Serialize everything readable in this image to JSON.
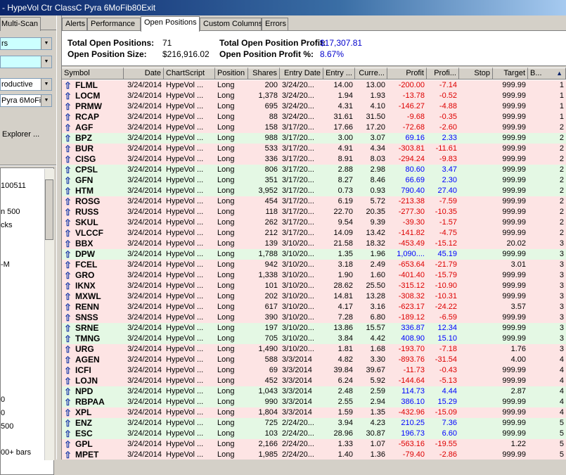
{
  "window": {
    "title": "- HypeVol Ctr ClassC Pyra 6MoFib80Exit"
  },
  "left_panel": {
    "tab_label": "Multi-Scan",
    "combo1": "rs",
    "combo2": "",
    "combo3": "roductive",
    "combo4": "Pyra 6MoFib",
    "explorer_label": "Explorer ...",
    "list_items": [
      "100511",
      "n 500",
      "cks",
      "-M",
      "0",
      "0",
      "500",
      "00+ bars"
    ]
  },
  "tabs": [
    "Alerts",
    "Performance",
    "Open Positions",
    "Custom Columns",
    "Errors"
  ],
  "summary": {
    "total_positions_label": "Total Open Positions:",
    "total_positions_value": "71",
    "position_size_label": "Open Position Size:",
    "position_size_value": "$216,916.02",
    "profit_label": "Total Open Position Profit:",
    "profit_value": "$17,307.81",
    "profit_pct_label": "Open Position Profit %:",
    "profit_pct_value": "8.67%"
  },
  "table": {
    "columns": [
      "Symbol",
      "Date",
      "ChartScript",
      "Position",
      "Shares",
      "Entry Date",
      "Entry ...",
      "Curre...",
      "Profit",
      "Profi...",
      "Stop",
      "Target",
      "B..."
    ],
    "sort_indicator": "▲",
    "rows": [
      {
        "symbol": "FLML",
        "date": "3/24/2014",
        "script": "HypeVol ...",
        "position": "Long",
        "shares": "200",
        "entry_date": "3/24/20...",
        "entry": "14.00",
        "current": "13.00",
        "profit": "-200.00",
        "profit_pct": "-7.14",
        "stop": "",
        "target": "999.99",
        "b": "1",
        "color": "red"
      },
      {
        "symbol": "LOCM",
        "date": "3/24/2014",
        "script": "HypeVol ...",
        "position": "Long",
        "shares": "1,378",
        "entry_date": "3/24/20...",
        "entry": "1.94",
        "current": "1.93",
        "profit": "-13.78",
        "profit_pct": "-0.52",
        "stop": "",
        "target": "999.99",
        "b": "1",
        "color": "red"
      },
      {
        "symbol": "PRMW",
        "date": "3/24/2014",
        "script": "HypeVol ...",
        "position": "Long",
        "shares": "695",
        "entry_date": "3/24/20...",
        "entry": "4.31",
        "current": "4.10",
        "profit": "-146.27",
        "profit_pct": "-4.88",
        "stop": "",
        "target": "999.99",
        "b": "1",
        "color": "red"
      },
      {
        "symbol": "RCAP",
        "date": "3/24/2014",
        "script": "HypeVol ...",
        "position": "Long",
        "shares": "88",
        "entry_date": "3/24/20...",
        "entry": "31.61",
        "current": "31.50",
        "profit": "-9.68",
        "profit_pct": "-0.35",
        "stop": "",
        "target": "999.99",
        "b": "1",
        "color": "red"
      },
      {
        "symbol": "AGF",
        "date": "3/24/2014",
        "script": "HypeVol ...",
        "position": "Long",
        "shares": "158",
        "entry_date": "3/17/20...",
        "entry": "17.66",
        "current": "17.20",
        "profit": "-72.68",
        "profit_pct": "-2.60",
        "stop": "",
        "target": "999.99",
        "b": "2",
        "color": "red"
      },
      {
        "symbol": "BPZ",
        "date": "3/24/2014",
        "script": "HypeVol ...",
        "position": "Long",
        "shares": "988",
        "entry_date": "3/17/20...",
        "entry": "3.00",
        "current": "3.07",
        "profit": "69.16",
        "profit_pct": "2.33",
        "stop": "",
        "target": "999.99",
        "b": "2",
        "color": "green"
      },
      {
        "symbol": "BUR",
        "date": "3/24/2014",
        "script": "HypeVol ...",
        "position": "Long",
        "shares": "533",
        "entry_date": "3/17/20...",
        "entry": "4.91",
        "current": "4.34",
        "profit": "-303.81",
        "profit_pct": "-11.61",
        "stop": "",
        "target": "999.99",
        "b": "2",
        "color": "red"
      },
      {
        "symbol": "CISG",
        "date": "3/24/2014",
        "script": "HypeVol ...",
        "position": "Long",
        "shares": "336",
        "entry_date": "3/17/20...",
        "entry": "8.91",
        "current": "8.03",
        "profit": "-294.24",
        "profit_pct": "-9.83",
        "stop": "",
        "target": "999.99",
        "b": "2",
        "color": "red"
      },
      {
        "symbol": "CPSL",
        "date": "3/24/2014",
        "script": "HypeVol ...",
        "position": "Long",
        "shares": "806",
        "entry_date": "3/17/20...",
        "entry": "2.88",
        "current": "2.98",
        "profit": "80.60",
        "profit_pct": "3.47",
        "stop": "",
        "target": "999.99",
        "b": "2",
        "color": "green"
      },
      {
        "symbol": "GFN",
        "date": "3/24/2014",
        "script": "HypeVol ...",
        "position": "Long",
        "shares": "351",
        "entry_date": "3/17/20...",
        "entry": "8.27",
        "current": "8.46",
        "profit": "66.69",
        "profit_pct": "2.30",
        "stop": "",
        "target": "999.99",
        "b": "2",
        "color": "green"
      },
      {
        "symbol": "HTM",
        "date": "3/24/2014",
        "script": "HypeVol ...",
        "position": "Long",
        "shares": "3,952",
        "entry_date": "3/17/20...",
        "entry": "0.73",
        "current": "0.93",
        "profit": "790.40",
        "profit_pct": "27.40",
        "stop": "",
        "target": "999.99",
        "b": "2",
        "color": "green"
      },
      {
        "symbol": "ROSG",
        "date": "3/24/2014",
        "script": "HypeVol ...",
        "position": "Long",
        "shares": "454",
        "entry_date": "3/17/20...",
        "entry": "6.19",
        "current": "5.72",
        "profit": "-213.38",
        "profit_pct": "-7.59",
        "stop": "",
        "target": "999.99",
        "b": "2",
        "color": "red"
      },
      {
        "symbol": "RUSS",
        "date": "3/24/2014",
        "script": "HypeVol ...",
        "position": "Long",
        "shares": "118",
        "entry_date": "3/17/20...",
        "entry": "22.70",
        "current": "20.35",
        "profit": "-277.30",
        "profit_pct": "-10.35",
        "stop": "",
        "target": "999.99",
        "b": "2",
        "color": "red"
      },
      {
        "symbol": "SKUL",
        "date": "3/24/2014",
        "script": "HypeVol ...",
        "position": "Long",
        "shares": "262",
        "entry_date": "3/17/20...",
        "entry": "9.54",
        "current": "9.39",
        "profit": "-39.30",
        "profit_pct": "-1.57",
        "stop": "",
        "target": "999.99",
        "b": "2",
        "color": "red"
      },
      {
        "symbol": "VLCCF",
        "date": "3/24/2014",
        "script": "HypeVol ...",
        "position": "Long",
        "shares": "212",
        "entry_date": "3/17/20...",
        "entry": "14.09",
        "current": "13.42",
        "profit": "-141.82",
        "profit_pct": "-4.75",
        "stop": "",
        "target": "999.99",
        "b": "2",
        "color": "red"
      },
      {
        "symbol": "BBX",
        "date": "3/24/2014",
        "script": "HypeVol ...",
        "position": "Long",
        "shares": "139",
        "entry_date": "3/10/20...",
        "entry": "21.58",
        "current": "18.32",
        "profit": "-453.49",
        "profit_pct": "-15.12",
        "stop": "",
        "target": "20.02",
        "b": "3",
        "color": "red"
      },
      {
        "symbol": "DPW",
        "date": "3/24/2014",
        "script": "HypeVol ...",
        "position": "Long",
        "shares": "1,788",
        "entry_date": "3/10/20...",
        "entry": "1.35",
        "current": "1.96",
        "profit": "1,090....",
        "profit_pct": "45.19",
        "stop": "",
        "target": "999.99",
        "b": "3",
        "color": "green"
      },
      {
        "symbol": "FCEL",
        "date": "3/24/2014",
        "script": "HypeVol ...",
        "position": "Long",
        "shares": "942",
        "entry_date": "3/10/20...",
        "entry": "3.18",
        "current": "2.49",
        "profit": "-653.64",
        "profit_pct": "-21.79",
        "stop": "",
        "target": "3.01",
        "b": "3",
        "color": "red"
      },
      {
        "symbol": "GRO",
        "date": "3/24/2014",
        "script": "HypeVol ...",
        "position": "Long",
        "shares": "1,338",
        "entry_date": "3/10/20...",
        "entry": "1.90",
        "current": "1.60",
        "profit": "-401.40",
        "profit_pct": "-15.79",
        "stop": "",
        "target": "999.99",
        "b": "3",
        "color": "red"
      },
      {
        "symbol": "IKNX",
        "date": "3/24/2014",
        "script": "HypeVol ...",
        "position": "Long",
        "shares": "101",
        "entry_date": "3/10/20...",
        "entry": "28.62",
        "current": "25.50",
        "profit": "-315.12",
        "profit_pct": "-10.90",
        "stop": "",
        "target": "999.99",
        "b": "3",
        "color": "red"
      },
      {
        "symbol": "MXWL",
        "date": "3/24/2014",
        "script": "HypeVol ...",
        "position": "Long",
        "shares": "202",
        "entry_date": "3/10/20...",
        "entry": "14.81",
        "current": "13.28",
        "profit": "-308.32",
        "profit_pct": "-10.31",
        "stop": "",
        "target": "999.99",
        "b": "3",
        "color": "red"
      },
      {
        "symbol": "RENN",
        "date": "3/24/2014",
        "script": "HypeVol ...",
        "position": "Long",
        "shares": "617",
        "entry_date": "3/10/20...",
        "entry": "4.17",
        "current": "3.16",
        "profit": "-623.17",
        "profit_pct": "-24.22",
        "stop": "",
        "target": "3.57",
        "b": "3",
        "color": "red"
      },
      {
        "symbol": "SNSS",
        "date": "3/24/2014",
        "script": "HypeVol ...",
        "position": "Long",
        "shares": "390",
        "entry_date": "3/10/20...",
        "entry": "7.28",
        "current": "6.80",
        "profit": "-189.12",
        "profit_pct": "-6.59",
        "stop": "",
        "target": "999.99",
        "b": "3",
        "color": "red"
      },
      {
        "symbol": "SRNE",
        "date": "3/24/2014",
        "script": "HypeVol ...",
        "position": "Long",
        "shares": "197",
        "entry_date": "3/10/20...",
        "entry": "13.86",
        "current": "15.57",
        "profit": "336.87",
        "profit_pct": "12.34",
        "stop": "",
        "target": "999.99",
        "b": "3",
        "color": "green"
      },
      {
        "symbol": "TMNG",
        "date": "3/24/2014",
        "script": "HypeVol ...",
        "position": "Long",
        "shares": "705",
        "entry_date": "3/10/20...",
        "entry": "3.84",
        "current": "4.42",
        "profit": "408.90",
        "profit_pct": "15.10",
        "stop": "",
        "target": "999.99",
        "b": "3",
        "color": "green"
      },
      {
        "symbol": "URG",
        "date": "3/24/2014",
        "script": "HypeVol ...",
        "position": "Long",
        "shares": "1,490",
        "entry_date": "3/10/20...",
        "entry": "1.81",
        "current": "1.68",
        "profit": "-193.70",
        "profit_pct": "-7.18",
        "stop": "",
        "target": "1.76",
        "b": "3",
        "color": "red"
      },
      {
        "symbol": "AGEN",
        "date": "3/24/2014",
        "script": "HypeVol ...",
        "position": "Long",
        "shares": "588",
        "entry_date": "3/3/2014",
        "entry": "4.82",
        "current": "3.30",
        "profit": "-893.76",
        "profit_pct": "-31.54",
        "stop": "",
        "target": "4.00",
        "b": "4",
        "color": "red"
      },
      {
        "symbol": "ICFI",
        "date": "3/24/2014",
        "script": "HypeVol ...",
        "position": "Long",
        "shares": "69",
        "entry_date": "3/3/2014",
        "entry": "39.84",
        "current": "39.67",
        "profit": "-11.73",
        "profit_pct": "-0.43",
        "stop": "",
        "target": "999.99",
        "b": "4",
        "color": "red"
      },
      {
        "symbol": "LOJN",
        "date": "3/24/2014",
        "script": "HypeVol ...",
        "position": "Long",
        "shares": "452",
        "entry_date": "3/3/2014",
        "entry": "6.24",
        "current": "5.92",
        "profit": "-144.64",
        "profit_pct": "-5.13",
        "stop": "",
        "target": "999.99",
        "b": "4",
        "color": "red"
      },
      {
        "symbol": "NPD",
        "date": "3/24/2014",
        "script": "HypeVol ...",
        "position": "Long",
        "shares": "1,043",
        "entry_date": "3/3/2014",
        "entry": "2.48",
        "current": "2.59",
        "profit": "114.73",
        "profit_pct": "4.44",
        "stop": "",
        "target": "2.87",
        "b": "4",
        "color": "green"
      },
      {
        "symbol": "RBPAA",
        "date": "3/24/2014",
        "script": "HypeVol ...",
        "position": "Long",
        "shares": "990",
        "entry_date": "3/3/2014",
        "entry": "2.55",
        "current": "2.94",
        "profit": "386.10",
        "profit_pct": "15.29",
        "stop": "",
        "target": "999.99",
        "b": "4",
        "color": "green"
      },
      {
        "symbol": "XPL",
        "date": "3/24/2014",
        "script": "HypeVol ...",
        "position": "Long",
        "shares": "1,804",
        "entry_date": "3/3/2014",
        "entry": "1.59",
        "current": "1.35",
        "profit": "-432.96",
        "profit_pct": "-15.09",
        "stop": "",
        "target": "999.99",
        "b": "4",
        "color": "red"
      },
      {
        "symbol": "ENZ",
        "date": "3/24/2014",
        "script": "HypeVol ...",
        "position": "Long",
        "shares": "725",
        "entry_date": "2/24/20...",
        "entry": "3.94",
        "current": "4.23",
        "profit": "210.25",
        "profit_pct": "7.36",
        "stop": "",
        "target": "999.99",
        "b": "5",
        "color": "green"
      },
      {
        "symbol": "ESC",
        "date": "3/24/2014",
        "script": "HypeVol ...",
        "position": "Long",
        "shares": "103",
        "entry_date": "2/24/20...",
        "entry": "28.96",
        "current": "30.87",
        "profit": "196.73",
        "profit_pct": "6.60",
        "stop": "",
        "target": "999.99",
        "b": "5",
        "color": "green"
      },
      {
        "symbol": "GPL",
        "date": "3/24/2014",
        "script": "HypeVol ...",
        "position": "Long",
        "shares": "2,166",
        "entry_date": "2/24/20...",
        "entry": "1.33",
        "current": "1.07",
        "profit": "-563.16",
        "profit_pct": "-19.55",
        "stop": "",
        "target": "1.22",
        "b": "5",
        "color": "red"
      },
      {
        "symbol": "MPET",
        "date": "3/24/2014",
        "script": "HypeVol ...",
        "position": "Long",
        "shares": "1,985",
        "entry_date": "2/24/20...",
        "entry": "1.40",
        "current": "1.36",
        "profit": "-79.40",
        "profit_pct": "-2.86",
        "stop": "",
        "target": "999.99",
        "b": "5",
        "color": "red"
      }
    ]
  },
  "colors": {
    "row_red": "#fde4e4",
    "row_green": "#e4f8e4",
    "negative": "#dd0000",
    "positive": "#0000ff",
    "symbol_icon": "#1a3aa8"
  },
  "icons": {
    "row_icon": "trend-arrow-icon",
    "sort": "sort-ascending-icon"
  }
}
